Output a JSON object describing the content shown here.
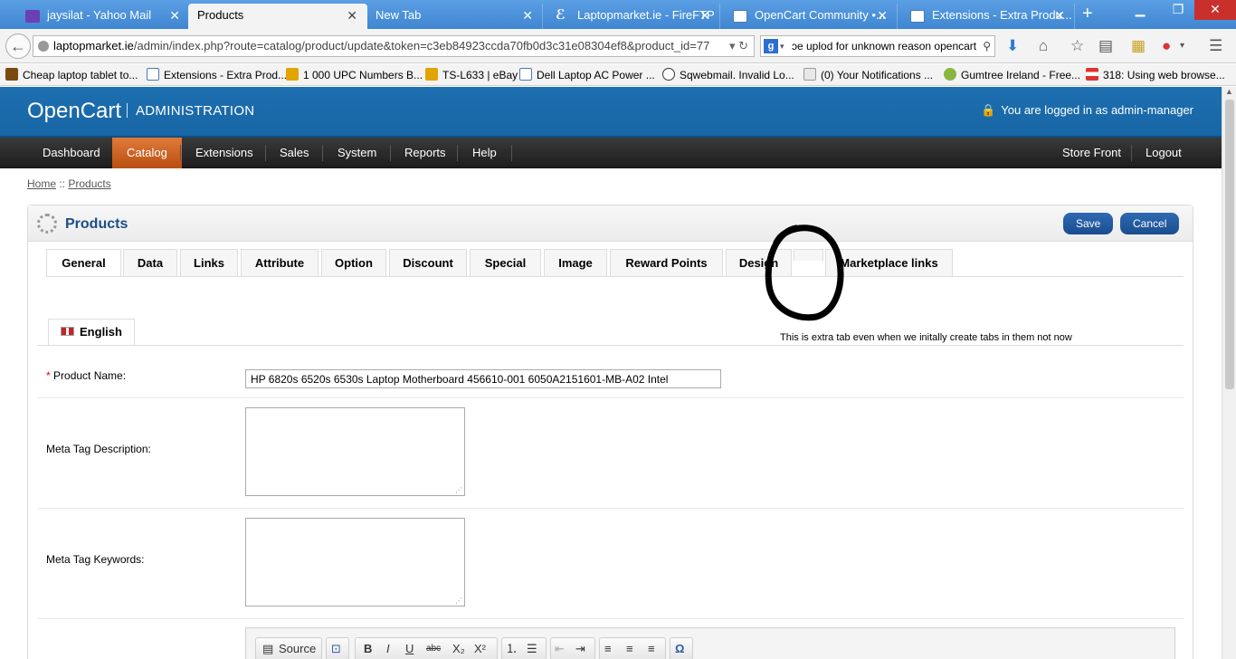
{
  "browser": {
    "tabs": [
      {
        "label": "jaysilat - Yahoo Mail",
        "color": "#6b3fb5"
      },
      {
        "label": "Products",
        "color": "#f3f3f3"
      },
      {
        "label": "New Tab",
        "color": ""
      },
      {
        "label": "Laptopmarket.ie - FireFTP",
        "color": "#2a6"
      },
      {
        "label": "OpenCart Community •...",
        "color": "#fff"
      },
      {
        "label": "Extensions - Extra Produ...",
        "color": "#fff"
      }
    ],
    "new_tab": "+",
    "url_host": "laptopmarket.ie",
    "url_path": "/admin/index.php?route=catalog/product/update&token=c3eb84923ccda70fb0d3c31e08304ef8&product_id=77",
    "search_text": "ɔe uplod for unknown reason opencart",
    "bookmarks": [
      "Cheap laptop tablet to...",
      "Extensions - Extra Prod...",
      "1 000 UPC Numbers B...",
      "TS-L633 | eBay",
      "Dell Laptop AC Power ...",
      "Sqwebmail. Invalid Lo...",
      "(0) Your Notifications ...",
      "Gumtree Ireland - Free...",
      "318: Using web browse..."
    ]
  },
  "header": {
    "logo": "OpenCart",
    "admin_label": "ADMINISTRATION",
    "login_text": "You are logged in as admin-manager"
  },
  "menu": {
    "items": [
      "Dashboard",
      "Catalog",
      "Extensions",
      "Sales",
      "System",
      "Reports",
      "Help"
    ],
    "active": "Catalog",
    "right": [
      "Store Front",
      "Logout"
    ]
  },
  "breadcrumb": {
    "home": "Home",
    "sep": " :: ",
    "current": "Products"
  },
  "box": {
    "title": "Products",
    "save": "Save",
    "cancel": "Cancel",
    "tabs": [
      "General",
      "Data",
      "Links",
      "Attribute",
      "Option",
      "Discount",
      "Special",
      "Image",
      "Reward Points",
      "Design",
      "",
      "Marketplace links"
    ],
    "language": "English"
  },
  "form": {
    "product_name_label": "Product Name:",
    "product_name_value": "HP 6820s 6520s 6530s Laptop Motherboard 456610-001 6050A2151601-MB-A02 Intel",
    "meta_desc_label": "Meta Tag Description:",
    "meta_keywords_label": "Meta Tag Keywords:"
  },
  "editor": {
    "source": "Source"
  },
  "annotation": {
    "text": "This is extra tab even when we initally create tabs in them not now"
  }
}
